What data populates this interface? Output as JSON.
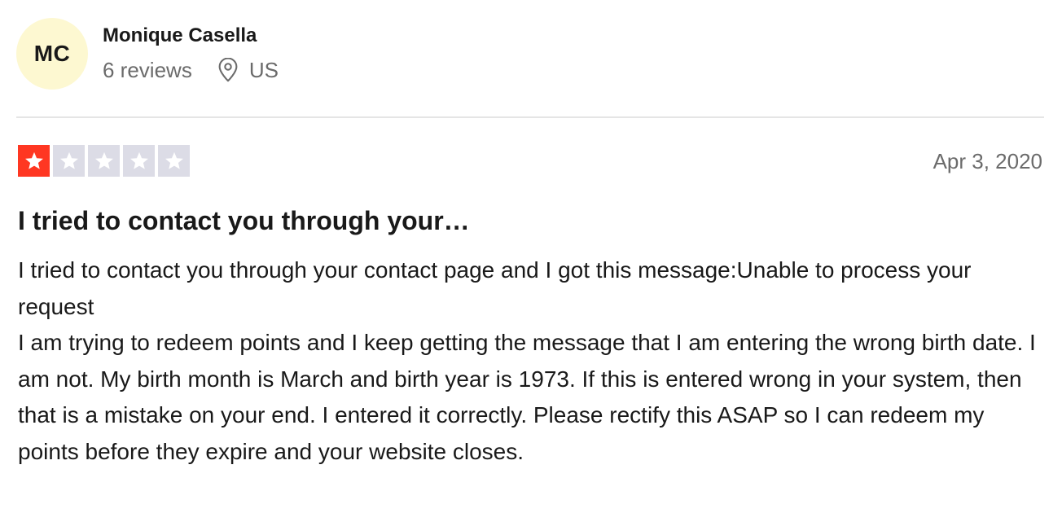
{
  "reviewer": {
    "initials": "MC",
    "name": "Monique Casella",
    "reviews_count": "6 reviews",
    "location": "US",
    "avatar_color": "#fdf8d1",
    "location_icon": "location-pin-icon"
  },
  "rating": {
    "stars": 1,
    "max": 5,
    "filled_color": "#ff3722",
    "empty_color": "#dcdce6"
  },
  "review": {
    "date": "Apr 3, 2020",
    "title": "I tried to contact you through your…",
    "body": "I tried to contact you through your contact page and I got this message:Unable to process your request\nI am trying to redeem points and I keep getting the message that I am entering the wrong birth date. I am not. My birth month is March and birth year is 1973. If this is entered wrong in your system, then that is a mistake on your end. I entered it correctly. Please rectify this ASAP so I can redeem my points before they expire and your website closes."
  }
}
